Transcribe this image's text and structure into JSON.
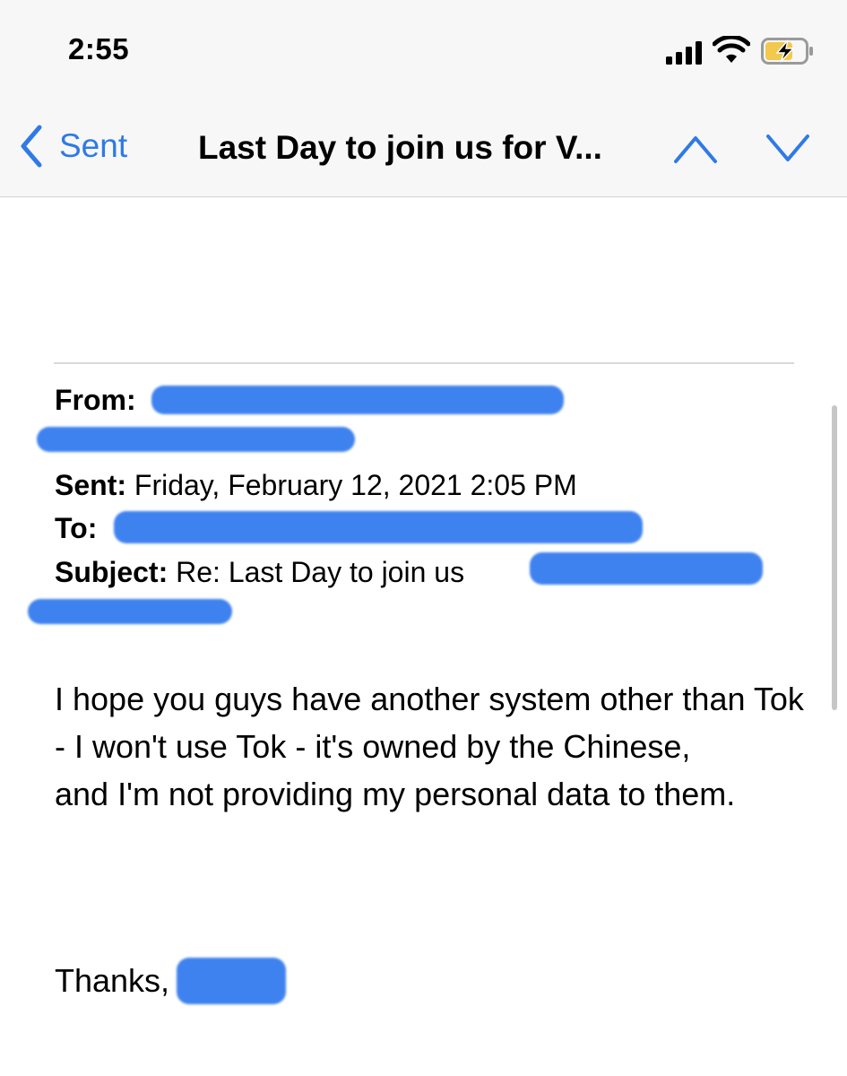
{
  "status_bar": {
    "time": "2:55",
    "icons": [
      "signal-icon",
      "wifi-icon",
      "battery-charging-icon"
    ]
  },
  "nav": {
    "back_label": "Sent",
    "title": "Last Day to join us for V...",
    "icons": [
      "back-chevron-icon",
      "previous-message-icon",
      "next-message-icon"
    ],
    "accent_color": "#2f7ae5"
  },
  "email_header": {
    "from_label": "From:",
    "sent_label": "Sent:",
    "sent_value": "Friday, February 12, 2021 2:05 PM",
    "to_label": "To:",
    "subject_label": "Subject:",
    "subject_value": "Re: Last Day to join us",
    "redaction_color": "#3b80f0"
  },
  "body": {
    "paragraphs": [
      "I hope you guys have another system other than Tok - I won't use Tok - it's owned by the Chinese,",
      "and I'm not providing my personal data to them."
    ],
    "signoff": "Thanks,"
  }
}
